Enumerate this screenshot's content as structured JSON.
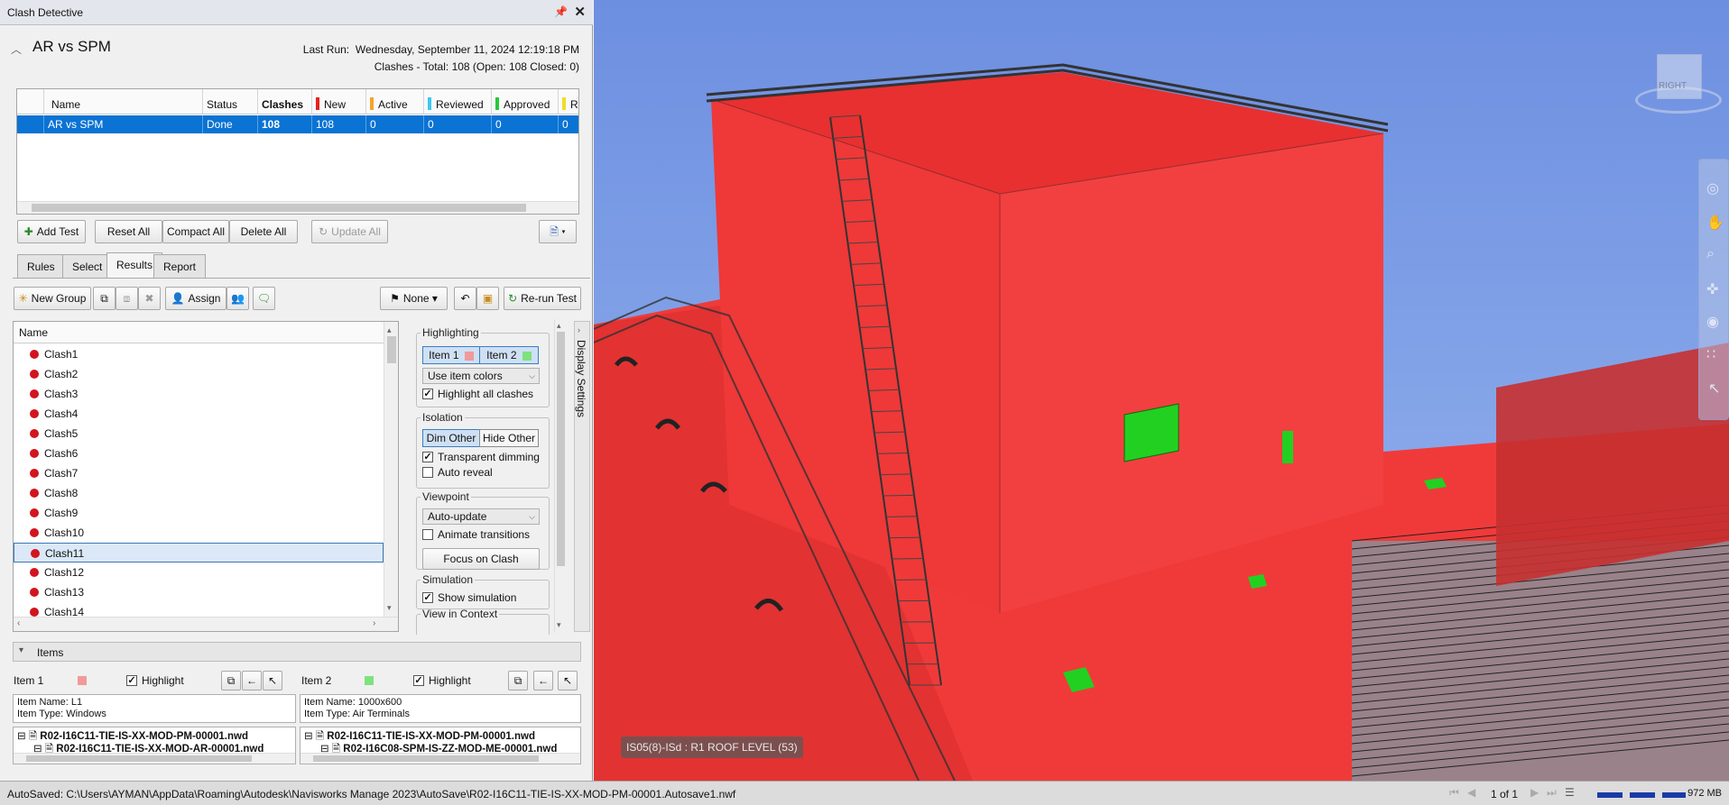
{
  "window": {
    "title": "Clash Detective"
  },
  "test": {
    "name": "AR vs SPM",
    "last_run_label": "Last Run:",
    "last_run": "Wednesday, September 11, 2024 12:19:18 PM",
    "totals": "Clashes - Total: 108 (Open: 108 Closed: 0)"
  },
  "tests_table": {
    "headers": [
      "Name",
      "Status",
      "Clashes",
      "New",
      "Active",
      "Reviewed",
      "Approved",
      "Reso"
    ],
    "row": [
      "AR vs SPM",
      "Done",
      "108",
      "108",
      "0",
      "0",
      "0",
      "0"
    ]
  },
  "colors": {
    "new": "#e0261f",
    "active": "#f2a52c",
    "reviewed": "#3cc8f0",
    "approved": "#28c83c",
    "resolved": "#f0dc28",
    "clash_dot": "#d2141e",
    "item1": "#f09a9a",
    "item2": "#7ee27e",
    "model_red": "#f03a3a",
    "sky": "#6d8fe0"
  },
  "toolbar1": {
    "add_test": "Add Test",
    "reset_all": "Reset All",
    "compact_all": "Compact All",
    "delete_all": "Delete All",
    "update_all": "Update All"
  },
  "tabs": [
    "Rules",
    "Select",
    "Results",
    "Report"
  ],
  "toolbar2": {
    "new_group": "New Group",
    "assign": "Assign",
    "none": "None",
    "rerun": "Re-run Test"
  },
  "results": {
    "header": "Name",
    "clashes": [
      "Clash1",
      "Clash2",
      "Clash3",
      "Clash4",
      "Clash5",
      "Clash6",
      "Clash7",
      "Clash8",
      "Clash9",
      "Clash10",
      "Clash11",
      "Clash12",
      "Clash13",
      "Clash14"
    ],
    "selected": "Clash11"
  },
  "display_settings": {
    "tab_label": "Display Settings",
    "highlighting": {
      "title": "Highlighting",
      "item1": "Item 1",
      "item2": "Item 2",
      "color_mode": "Use item colors",
      "highlight_all": "Highlight all clashes"
    },
    "isolation": {
      "title": "Isolation",
      "dim_other": "Dim Other",
      "hide_other": "Hide Other",
      "transparent": "Transparent dimming",
      "auto_reveal": "Auto reveal"
    },
    "viewpoint": {
      "title": "Viewpoint",
      "mode": "Auto-update",
      "animate": "Animate transitions",
      "focus": "Focus on Clash"
    },
    "simulation": {
      "title": "Simulation",
      "show": "Show simulation"
    },
    "view_in_context": {
      "title": "View in Context"
    }
  },
  "items": {
    "title": "Items",
    "item1": {
      "label": "Item 1",
      "highlight": "Highlight",
      "name": "Item Name: L1",
      "type": "Item Type: Windows",
      "file": "R02-I16C11-TIE-IS-XX-MOD-PM-00001.nwd",
      "sub": "R02-I16C11-TIE-IS-XX-MOD-AR-00001.nwd"
    },
    "item2": {
      "label": "Item 2",
      "highlight": "Highlight",
      "name": "Item Name: 1000x600",
      "type": "Item Type: Air Terminals",
      "file": "R02-I16C11-TIE-IS-XX-MOD-PM-00001.nwd",
      "sub": "R02-I16C08-SPM-IS-ZZ-MOD-ME-00001.nwd"
    }
  },
  "viewport": {
    "view_label": "IS05(8)-ISd : R1 ROOF LEVEL (53)",
    "viewcube_face": "RIGHT"
  },
  "status": {
    "autosave": "AutoSaved: C:\\Users\\AYMAN\\AppData\\Roaming\\Autodesk\\Navisworks Manage 2023\\AutoSave\\R02-I16C11-TIE-IS-XX-MOD-PM-00001.Autosave1.nwf",
    "page": "1 of 1",
    "memory": "972 MB"
  }
}
